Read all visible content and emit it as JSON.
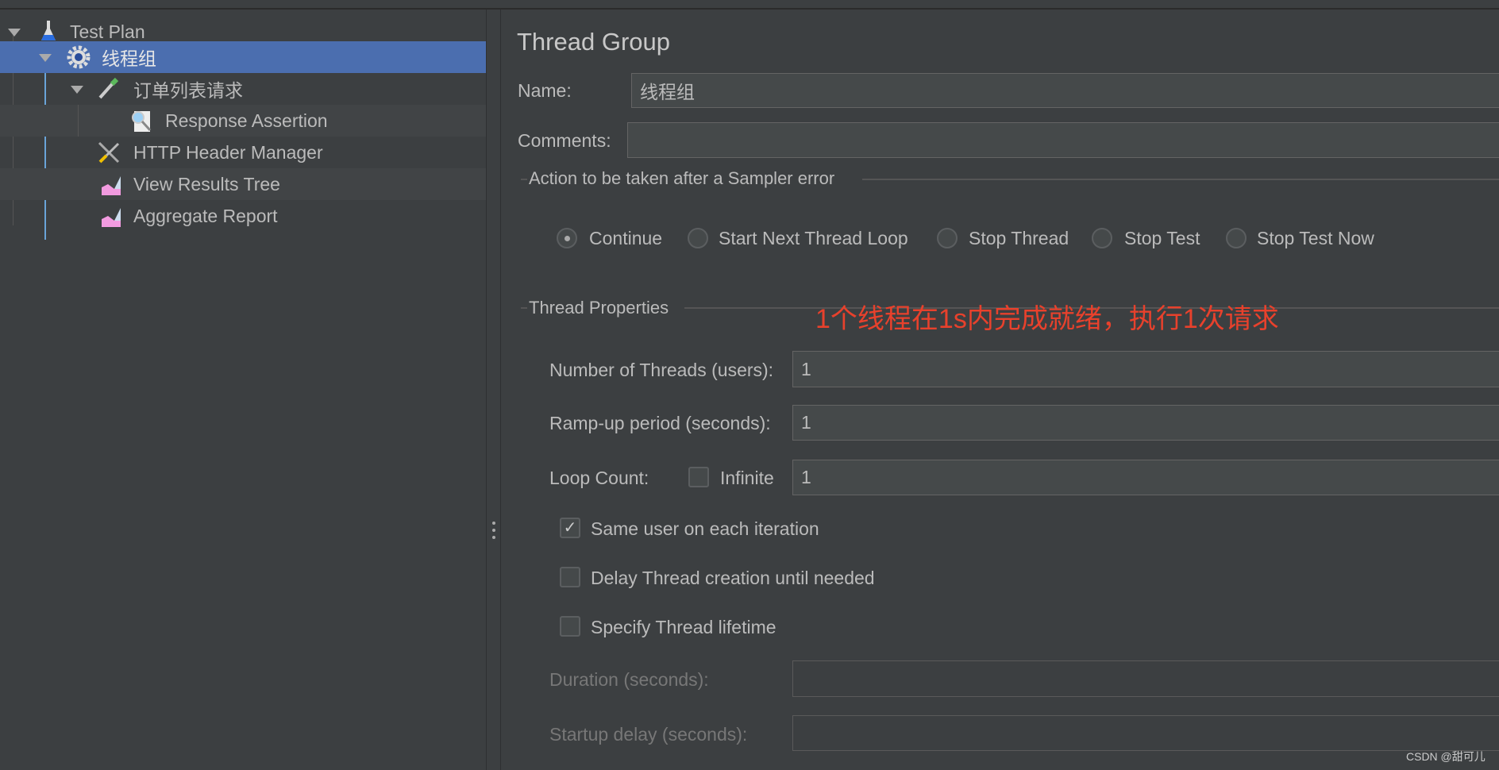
{
  "tree": {
    "items": [
      {
        "label": "Test Plan",
        "icon": "flask-icon"
      },
      {
        "label": "线程组",
        "icon": "gear-icon",
        "selected": true
      },
      {
        "label": "订单列表请求",
        "icon": "pipette-icon"
      },
      {
        "label": "Response Assertion",
        "icon": "magnifier-icon"
      },
      {
        "label": "HTTP Header Manager",
        "icon": "tools-icon"
      },
      {
        "label": "View Results Tree",
        "icon": "graph-icon"
      },
      {
        "label": "Aggregate Report",
        "icon": "graph-icon"
      }
    ]
  },
  "panel": {
    "title": "Thread Group",
    "name_label": "Name:",
    "name_value": "线程组",
    "comments_label": "Comments:",
    "comments_value": "",
    "action_section": "Action to be taken after a Sampler error",
    "actions": [
      {
        "label": "Continue",
        "selected": true
      },
      {
        "label": "Start Next Thread Loop",
        "selected": false
      },
      {
        "label": "Stop Thread",
        "selected": false
      },
      {
        "label": "Stop Test",
        "selected": false
      },
      {
        "label": "Stop Test Now",
        "selected": false
      }
    ],
    "props_section": "Thread Properties",
    "annotation": "1个线程在1s内完成就绪，执行1次请求",
    "annotation_color": "#e8412c",
    "threads_label": "Number of Threads (users):",
    "threads_value": "1",
    "rampup_label": "Ramp-up period (seconds):",
    "rampup_value": "1",
    "loop_label": "Loop Count:",
    "infinite_label": "Infinite",
    "infinite_checked": false,
    "loop_value": "1",
    "same_user_label": "Same user on each iteration",
    "same_user_checked": true,
    "delay_label": "Delay Thread creation until needed",
    "delay_checked": false,
    "lifetime_label": "Specify Thread lifetime",
    "lifetime_checked": false,
    "duration_label": "Duration (seconds):",
    "duration_value": "",
    "startup_label": "Startup delay (seconds):",
    "startup_value": ""
  },
  "watermark": "CSDN @甜可儿"
}
